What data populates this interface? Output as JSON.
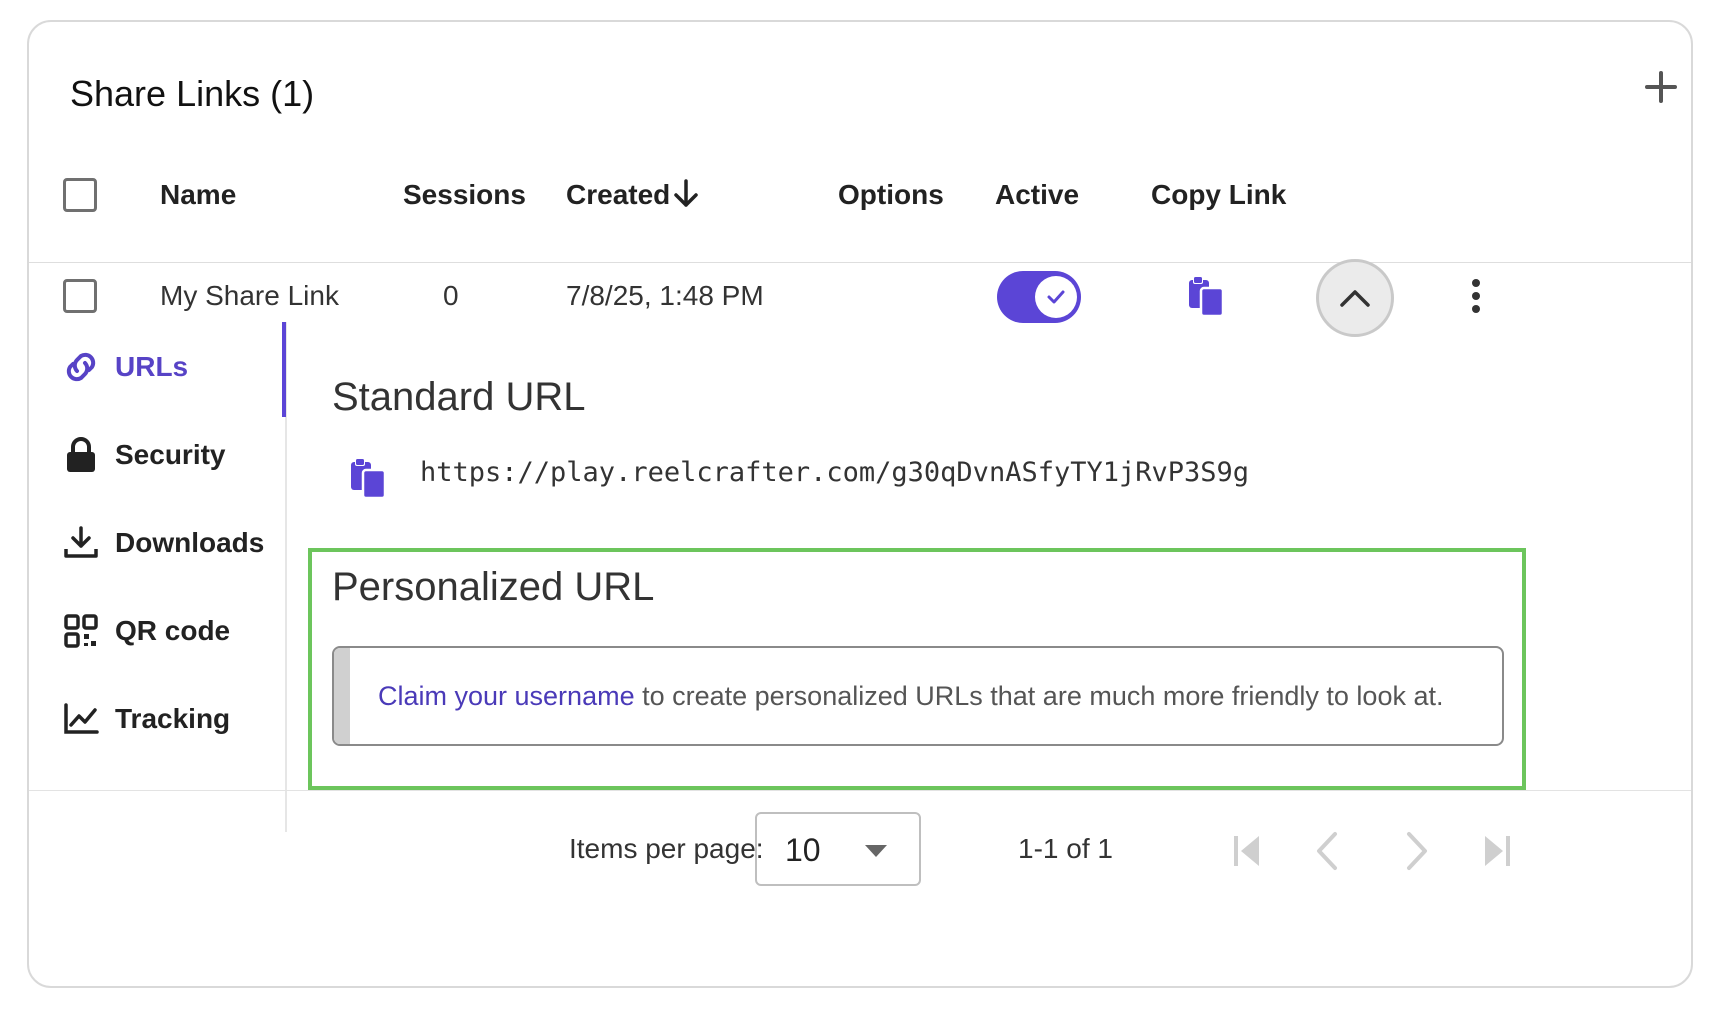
{
  "panel": {
    "title": "Share Links (1)",
    "add_icon": "plus-icon"
  },
  "table": {
    "columns": {
      "name": "Name",
      "sessions": "Sessions",
      "created": "Created",
      "options": "Options",
      "active": "Active",
      "copy_link": "Copy Link"
    },
    "sort": {
      "column": "created",
      "direction": "descending",
      "icon": "arrow-down-icon"
    },
    "rows": [
      {
        "name": "My Share Link",
        "sessions": "0",
        "created": "7/8/25, 1:48 PM",
        "active": true,
        "expanded": true
      }
    ]
  },
  "side_nav": {
    "active": "urls",
    "items": [
      {
        "id": "urls",
        "label": "URLs",
        "icon": "link-icon"
      },
      {
        "id": "security",
        "label": "Security",
        "icon": "lock-icon"
      },
      {
        "id": "downloads",
        "label": "Downloads",
        "icon": "download-icon"
      },
      {
        "id": "qr",
        "label": "QR code",
        "icon": "qr-code-icon"
      },
      {
        "id": "tracking",
        "label": "Tracking",
        "icon": "chart-line-icon"
      }
    ]
  },
  "urls": {
    "standard_heading": "Standard URL",
    "standard_url": "https://play.reelcrafter.com/g30qDvnASfyTY1jRvP3S9g",
    "personalized_heading": "Personalized URL",
    "claim_link": "Claim your username",
    "claim_text": " to create personalized URLs that are much more friendly to look at."
  },
  "pagination": {
    "items_per_page_label": "Items per page:",
    "items_per_page": "10",
    "range": "1-1 of 1"
  },
  "colors": {
    "accent": "#5b45d6",
    "highlight": "#6cc55c",
    "link": "#4a3ab8"
  }
}
